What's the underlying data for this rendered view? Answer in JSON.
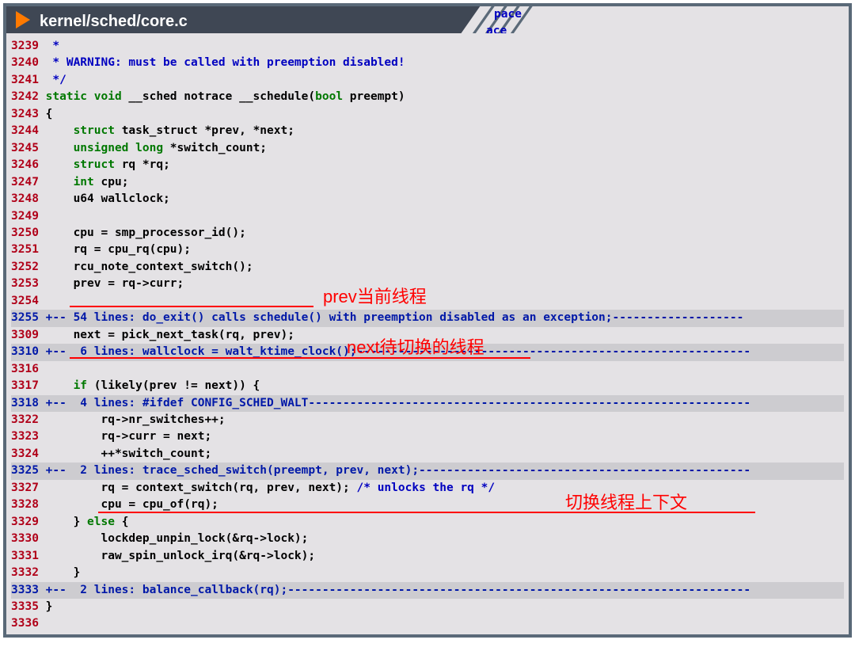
{
  "header": {
    "title": "kernel/sched/core.c",
    "peek_line1": "pace",
    "peek_line2": "ace"
  },
  "code": {
    "lines": [
      {
        "n": "3239",
        "kind": "cmt",
        "text": " *"
      },
      {
        "n": "3240",
        "kind": "cmt",
        "text": " * WARNING: must be called with preemption disabled!"
      },
      {
        "n": "3241",
        "kind": "cmt",
        "text": " */"
      },
      {
        "n": "3242",
        "kind": "mixed",
        "parts": [
          {
            "c": "kw",
            "t": "static void"
          },
          {
            "c": "txt",
            "t": " __sched notrace __schedule("
          },
          {
            "c": "kw",
            "t": "bool"
          },
          {
            "c": "txt",
            "t": " preempt)"
          }
        ]
      },
      {
        "n": "3243",
        "kind": "txt",
        "text": "{"
      },
      {
        "n": "3244",
        "kind": "mixed",
        "parts": [
          {
            "c": "txt",
            "t": "    "
          },
          {
            "c": "kw",
            "t": "struct"
          },
          {
            "c": "txt",
            "t": " task_struct *prev, *next;"
          }
        ]
      },
      {
        "n": "3245",
        "kind": "mixed",
        "parts": [
          {
            "c": "txt",
            "t": "    "
          },
          {
            "c": "kw",
            "t": "unsigned long"
          },
          {
            "c": "txt",
            "t": " *switch_count;"
          }
        ]
      },
      {
        "n": "3246",
        "kind": "mixed",
        "parts": [
          {
            "c": "txt",
            "t": "    "
          },
          {
            "c": "kw",
            "t": "struct"
          },
          {
            "c": "txt",
            "t": " rq *rq;"
          }
        ]
      },
      {
        "n": "3247",
        "kind": "mixed",
        "parts": [
          {
            "c": "txt",
            "t": "    "
          },
          {
            "c": "kw",
            "t": "int"
          },
          {
            "c": "txt",
            "t": " cpu;"
          }
        ]
      },
      {
        "n": "3248",
        "kind": "txt",
        "text": "    u64 wallclock;"
      },
      {
        "n": "3249",
        "kind": "txt",
        "text": ""
      },
      {
        "n": "3250",
        "kind": "txt",
        "text": "    cpu = smp_processor_id();"
      },
      {
        "n": "3251",
        "kind": "txt",
        "text": "    rq = cpu_rq(cpu);"
      },
      {
        "n": "3252",
        "kind": "txt",
        "text": "    rcu_note_context_switch();"
      },
      {
        "n": "3253",
        "kind": "txt",
        "text": "    prev = rq->curr;"
      },
      {
        "n": "3254",
        "kind": "txt",
        "text": ""
      },
      {
        "n": "3255",
        "kind": "fold",
        "text": "+-- 54 lines: do_exit() calls schedule() with preemption disabled as an exception;-------------------"
      },
      {
        "n": "3309",
        "kind": "txt",
        "text": "    next = pick_next_task(rq, prev);"
      },
      {
        "n": "3310",
        "kind": "fold",
        "text": "+--  6 lines: wallclock = walt_ktime_clock();---------------------------------------------------------"
      },
      {
        "n": "3316",
        "kind": "txt",
        "text": ""
      },
      {
        "n": "3317",
        "kind": "mixed",
        "parts": [
          {
            "c": "txt",
            "t": "    "
          },
          {
            "c": "kw",
            "t": "if"
          },
          {
            "c": "txt",
            "t": " (likely(prev != next)) {"
          }
        ]
      },
      {
        "n": "3318",
        "kind": "fold",
        "text": "+--  4 lines: #ifdef CONFIG_SCHED_WALT----------------------------------------------------------------"
      },
      {
        "n": "3322",
        "kind": "txt",
        "text": "        rq->nr_switches++;"
      },
      {
        "n": "3323",
        "kind": "txt",
        "text": "        rq->curr = next;"
      },
      {
        "n": "3324",
        "kind": "txt",
        "text": "        ++*switch_count;"
      },
      {
        "n": "3325",
        "kind": "fold",
        "text": "+--  2 lines: trace_sched_switch(preempt, prev, next);------------------------------------------------"
      },
      {
        "n": "3327",
        "kind": "mixed",
        "parts": [
          {
            "c": "txt",
            "t": "        rq = context_switch(rq, prev, next); "
          },
          {
            "c": "cmt",
            "t": "/* unlocks the rq */"
          }
        ]
      },
      {
        "n": "3328",
        "kind": "txt",
        "text": "        cpu = cpu_of(rq);"
      },
      {
        "n": "3329",
        "kind": "mixed",
        "parts": [
          {
            "c": "txt",
            "t": "    } "
          },
          {
            "c": "kw",
            "t": "else"
          },
          {
            "c": "txt",
            "t": " {"
          }
        ]
      },
      {
        "n": "3330",
        "kind": "txt",
        "text": "        lockdep_unpin_lock(&rq->lock);"
      },
      {
        "n": "3331",
        "kind": "txt",
        "text": "        raw_spin_unlock_irq(&rq->lock);"
      },
      {
        "n": "3332",
        "kind": "txt",
        "text": "    }"
      },
      {
        "n": "3333",
        "kind": "fold",
        "text": "+--  2 lines: balance_callback(rq);-------------------------------------------------------------------"
      },
      {
        "n": "3335",
        "kind": "txt",
        "text": "}"
      },
      {
        "n": "3336",
        "kind": "txt",
        "text": ""
      }
    ]
  },
  "annotations": {
    "a1": "prev当前线程",
    "a2": "next待切换的线程",
    "a3": "切换线程上下文"
  }
}
